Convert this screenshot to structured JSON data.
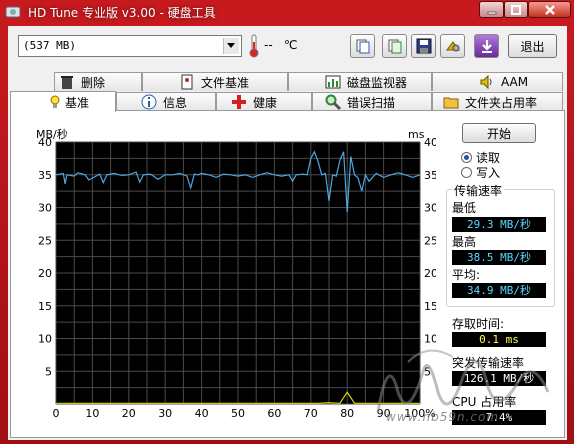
{
  "window": {
    "title": "HD Tune 专业版 v3.00 - 硬盘工具",
    "controls": [
      "minimize-icon",
      "maximize-icon",
      "close-icon"
    ],
    "frame_color": "#b01218"
  },
  "toolbar": {
    "drive_value": "(537 MB)",
    "temperature": "--",
    "temperature_unit": "℃",
    "buttons": [
      "copy-text-icon",
      "copy-info-icon",
      "save-icon",
      "options-icon",
      "download-icon"
    ],
    "exit_label": "退出"
  },
  "tabs_top": [
    {
      "label": "删除",
      "icon": "trash-icon"
    },
    {
      "label": "文件基准",
      "icon": "file-benchmark-icon"
    },
    {
      "label": "磁盘监视器",
      "icon": "disk-monitor-icon"
    },
    {
      "label": "AAM",
      "icon": "speaker-icon"
    }
  ],
  "tabs_bottom": [
    {
      "label": "基准",
      "icon": "lightbulb-icon",
      "active": true
    },
    {
      "label": "信息",
      "icon": "info-icon"
    },
    {
      "label": "健康",
      "icon": "health-icon"
    },
    {
      "label": "错误扫描",
      "icon": "magnifier-icon"
    },
    {
      "label": "文件夹占用率",
      "icon": "folder-icon"
    }
  ],
  "benchmark": {
    "start_label": "开始",
    "read_label": "读取",
    "write_label": "写入",
    "selected_mode": "read",
    "transfer_rate_title": "传输速率",
    "min_label": "最低",
    "min_value": "29.3 MB/秒",
    "max_label": "最高",
    "max_value": "38.5 MB/秒",
    "avg_label": "平均:",
    "avg_value": "34.9 MB/秒",
    "access_time_label": "存取时间:",
    "access_time_value": "0.1 ms",
    "burst_rate_label": "突发传输速率",
    "burst_rate_value": "126.1 MB/秒",
    "cpu_label": "CPU 占用率",
    "cpu_value": "7.4%"
  },
  "watermark": {
    "url": "www.nb59n.com"
  },
  "chart_data": {
    "type": "line",
    "left_axis_label": "MB/秒",
    "right_axis_label": "ms",
    "yticks": [
      5,
      10,
      15,
      20,
      25,
      30,
      35,
      40
    ],
    "ylim": [
      0,
      40
    ],
    "xticks": [
      "0",
      "10",
      "20",
      "30",
      "40",
      "50",
      "60",
      "70",
      "80",
      "90",
      "100%"
    ],
    "xlim": [
      0,
      100
    ],
    "grid": true,
    "background": "#000000",
    "grid_color": "#4a4a4a",
    "series": [
      {
        "color": "#4fa6e0",
        "x": [
          0,
          2,
          2.5,
          3,
          5,
          6,
          8,
          9,
          12,
          13,
          14,
          16,
          18,
          20,
          22,
          23,
          24,
          26,
          28,
          30,
          32,
          34,
          36,
          37,
          38,
          39,
          40,
          42,
          44,
          46,
          48,
          50,
          52,
          54,
          56,
          58,
          60,
          62,
          64,
          65,
          66,
          68,
          69,
          70,
          71,
          72,
          73,
          74,
          75,
          76,
          77,
          78,
          79,
          80,
          81,
          82,
          83,
          84,
          85,
          86,
          88,
          90,
          92,
          94,
          96,
          98,
          100
        ],
        "y": [
          35,
          35.2,
          33.6,
          35,
          34.8,
          35.3,
          35,
          34.2,
          35.1,
          33.8,
          35,
          35.2,
          34.9,
          35,
          35.4,
          33.9,
          35,
          35.1,
          34.3,
          35,
          35,
          35.2,
          34.8,
          33,
          35.1,
          35,
          35.2,
          35,
          34.6,
          35.1,
          35,
          34.8,
          35,
          34.6,
          35,
          35.3,
          35,
          34.8,
          35,
          34,
          35,
          35.1,
          35,
          37.5,
          38.5,
          37,
          35,
          35.2,
          31,
          35,
          34.8,
          37.2,
          38.5,
          29.3,
          37.8,
          35,
          34.5,
          32.5,
          35,
          34,
          35.2,
          34.6,
          35,
          35.3,
          35,
          34.6,
          35
        ]
      },
      {
        "color": "#d8d800",
        "x": [
          0,
          10,
          20,
          30,
          40,
          50,
          60,
          70,
          72,
          75,
          78,
          80,
          82,
          85,
          90,
          100
        ],
        "y": [
          0.1,
          0.1,
          0.1,
          0.1,
          0.1,
          0.1,
          0.1,
          0.1,
          0.1,
          0.2,
          0.1,
          1.8,
          0.1,
          0.1,
          0.1,
          0.1
        ]
      }
    ]
  }
}
